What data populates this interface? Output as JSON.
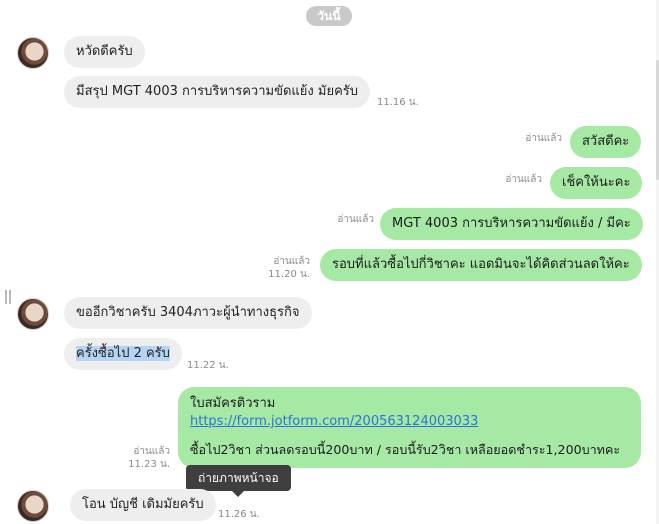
{
  "date_label": "วันนี้",
  "messages": {
    "m1": {
      "text": "หวัดดีครับ"
    },
    "m2": {
      "text": "มีสรุป MGT 4003 การบริหารความขัดแย้ง มัยครับ",
      "time": "11.16 น."
    },
    "m3": {
      "text": "สวัสดีคะ",
      "read": "อ่านแล้ว"
    },
    "m4": {
      "text": "เช็คให้นะคะ",
      "read": "อ่านแล้ว"
    },
    "m5": {
      "text": "MGT 4003 การบริหารความขัดแย้ง / มีคะ",
      "read": "อ่านแล้ว"
    },
    "m6": {
      "text": "รอบที่แล้วซื้อไปกี่วิชาคะ แอดมินจะได้คิดส่วนลดให้คะ",
      "read": "อ่านแล้ว",
      "time": "11.20 น."
    },
    "m7": {
      "text": "ขออีกวิชาครับ 3404ภาวะผู้นำทางธุรกิจ"
    },
    "m8": {
      "text": "ครั้งซื้อไป 2 ครับ",
      "time": "11.22 น."
    },
    "m9": {
      "line1": "ใบสมัครติวราม",
      "link": "https://form.jotform.com/200563124003033",
      "line3": "ซื้อไป2วิชา ส่วนลดรอบนี้200บาท / รอบนี้รับ2วิชา เหลือยอดชำระ1,200บาทคะ",
      "read": "อ่านแล้ว",
      "time": "11.23 น."
    },
    "m10": {
      "text": "โอน บัญชี เดิมมัยครับ",
      "time": "11.26 น."
    }
  },
  "tooltip": "ถ่ายภาพหน้าจอ"
}
